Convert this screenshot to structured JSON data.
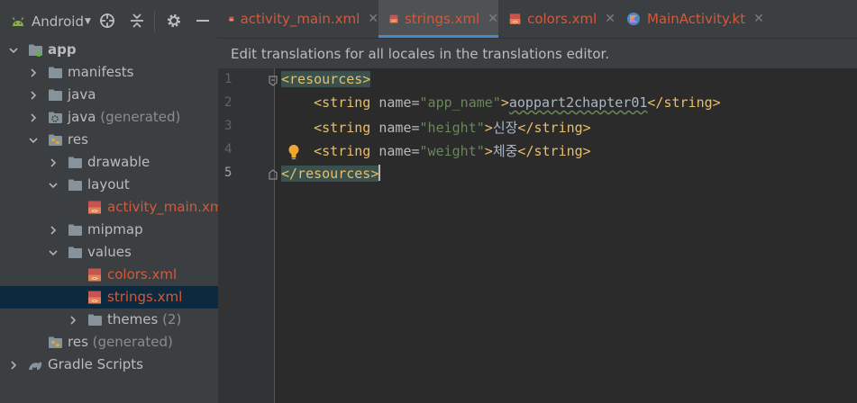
{
  "project_view": {
    "mode": "Android",
    "tree": [
      {
        "label": "app",
        "level": 0,
        "expanded": true,
        "icon": "module-icon",
        "bold": true
      },
      {
        "label": "manifests",
        "level": 1,
        "expanded": false,
        "icon": "folder-icon"
      },
      {
        "label": "java",
        "level": 1,
        "expanded": false,
        "icon": "folder-icon"
      },
      {
        "label": "java",
        "suffix": "(generated)",
        "level": 1,
        "expanded": false,
        "icon": "generated-folder-icon"
      },
      {
        "label": "res",
        "level": 1,
        "expanded": true,
        "icon": "res-folder-icon"
      },
      {
        "label": "drawable",
        "level": 2,
        "expanded": false,
        "icon": "folder-icon"
      },
      {
        "label": "layout",
        "level": 2,
        "expanded": true,
        "icon": "folder-icon"
      },
      {
        "label": "activity_main.xml",
        "level": 3,
        "icon": "xml-file-icon",
        "red": true
      },
      {
        "label": "mipmap",
        "level": 2,
        "expanded": false,
        "icon": "folder-icon"
      },
      {
        "label": "values",
        "level": 2,
        "expanded": true,
        "icon": "folder-icon"
      },
      {
        "label": "colors.xml",
        "level": 3,
        "icon": "xml-file-icon",
        "red": true
      },
      {
        "label": "strings.xml",
        "level": 3,
        "icon": "xml-file-icon",
        "red": true,
        "selected": true
      },
      {
        "label": "themes",
        "suffix": "(2)",
        "level": 3,
        "expanded": false,
        "icon": "folder-icon"
      },
      {
        "label": "res",
        "suffix": "(generated)",
        "level": 1,
        "icon": "res-folder-icon"
      },
      {
        "label": "Gradle Scripts",
        "level": 0,
        "expanded": false,
        "icon": "gradle-icon"
      }
    ]
  },
  "tabs": [
    {
      "label": "activity_main.xml",
      "icon": "xml-file-icon",
      "active": false
    },
    {
      "label": "strings.xml",
      "icon": "xml-file-icon",
      "active": true
    },
    {
      "label": "colors.xml",
      "icon": "xml-file-icon",
      "active": false
    },
    {
      "label": "MainActivity.kt",
      "icon": "kotlin-file-icon",
      "active": false
    }
  ],
  "close_glyph": "✕",
  "banner": {
    "text": "Edit translations for all locales in the translations editor."
  },
  "editor": {
    "current_line": "5",
    "lines": [
      {
        "num": "1",
        "open": "<resources>"
      },
      {
        "num": "2",
        "tag_open": "<string",
        "attr": "name=",
        "value": "\"app_name\"",
        "gt": ">",
        "text": "aoppart2chapter01",
        "tag_close": "</string>"
      },
      {
        "num": "3",
        "tag_open": "<string",
        "attr": "name=",
        "value": "\"height\"",
        "gt": ">",
        "text": "신장",
        "tag_close": "</string>"
      },
      {
        "num": "4",
        "tag_open": "<string",
        "attr": "name=",
        "value": "\"weight\"",
        "gt": ">",
        "text": "체중",
        "tag_close": "</string>"
      },
      {
        "num": "5",
        "close": "</resources>"
      }
    ]
  },
  "colors": {
    "accent": "#4a88c7",
    "file_red": "#d3593b",
    "tag": "#e8bf6a",
    "attr_value": "#6a8759"
  }
}
